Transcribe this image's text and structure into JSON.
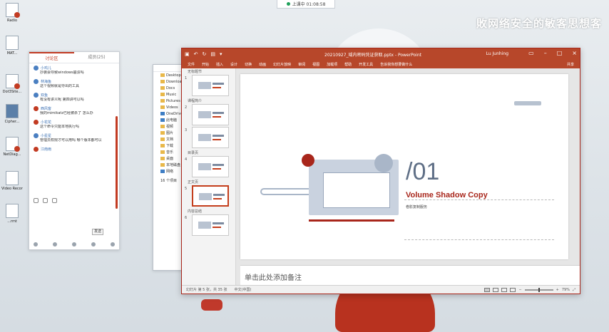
{
  "desktop": {
    "icons": [
      {
        "label": "Radio",
        "style": "red"
      },
      {
        "label": "MAT...",
        "style": "plain"
      },
      {
        "label": "Dot3Site...",
        "style": "red"
      },
      {
        "label": "Cipher...",
        "style": "blue"
      },
      {
        "label": "NetDiag...",
        "style": "red"
      },
      {
        "label": "Video Recording",
        "style": "plain"
      },
      {
        "label": "...rmt",
        "style": "plain"
      }
    ],
    "watermark": "敗网络安全的敏客思想客"
  },
  "meeting_bar": {
    "label": "上课中 01:08:58"
  },
  "chat": {
    "tabs": [
      "讨论区",
      "成员(25)"
    ],
    "active_tab": 0,
    "messages": [
      {
        "user": "小鸡儿",
        "text": "抄袭会导致windows崩溃吗",
        "avatar": "blue"
      },
      {
        "user": "林海鱼",
        "text": "这个视频就是导出的工具",
        "avatar": "blue"
      },
      {
        "user": "双鱼",
        "text": "有没有讲义呢 第四讲可以吗",
        "avatar": "blue"
      },
      {
        "user": "西风客",
        "text": "我的mimikatz已经被杀了 怎么办",
        "avatar": "red"
      },
      {
        "user": "小花花",
        "text": "这个命令只能本地执行吗",
        "avatar": "red"
      },
      {
        "user": "小星星",
        "text": "管理员权限才可以用吗 哪个版本都可以",
        "avatar": "blue"
      },
      {
        "user": "江南雨",
        "text": "",
        "avatar": "red"
      }
    ],
    "send_label": "发送"
  },
  "explorer": {
    "items": [
      {
        "label": "Desktop",
        "icon": "folder-icon"
      },
      {
        "label": "Downloads",
        "icon": "folder-icon"
      },
      {
        "label": "Docs",
        "icon": "folder-icon"
      },
      {
        "label": "Music",
        "icon": "folder-icon"
      },
      {
        "label": "Pictures",
        "icon": "folder-icon"
      },
      {
        "label": "Videos",
        "icon": "folder-icon"
      },
      {
        "label": "OneDrive",
        "icon": "cloud-icon"
      },
      {
        "label": "此电脑",
        "icon": "computer-icon"
      },
      {
        "label": "视频",
        "icon": "folder-icon"
      },
      {
        "label": "图片",
        "icon": "folder-icon"
      },
      {
        "label": "文档",
        "icon": "folder-icon"
      },
      {
        "label": "下载",
        "icon": "folder-icon"
      },
      {
        "label": "音乐",
        "icon": "folder-icon"
      },
      {
        "label": "桌面",
        "icon": "folder-icon"
      },
      {
        "label": "本地磁盘",
        "icon": "drive-icon"
      },
      {
        "label": "网络",
        "icon": "network-icon"
      }
    ],
    "footer": "16 个项目"
  },
  "ppt": {
    "doc_title": "20210927_域内密码凭证获取.pptx - PowerPoint",
    "user": "Lu Junhing",
    "ribbon_tabs": [
      "文件",
      "开始",
      "插入",
      "设计",
      "切换",
      "动画",
      "幻灯片放映",
      "审阅",
      "视图",
      "加载项",
      "帮助",
      "开发工具",
      "告诉我你想要做什么"
    ],
    "share_label": "共享",
    "sections": [
      "无标题节",
      "课程简介",
      "目录页",
      "正文页",
      "内容总结"
    ],
    "thumb_numbers": [
      "1",
      "2",
      "3",
      "4",
      "5",
      "6"
    ],
    "slide": {
      "number": "/01",
      "heading": "Volume Shadow Copy",
      "subheading": "卷影复制服务"
    },
    "notes_placeholder": "单击此处添加备注",
    "status": {
      "slide_info": "幻灯片 第 5 张，共 35 张",
      "language": "中文(中国)",
      "zoom": "79%",
      "zoom_fraction": 0.5
    },
    "colors": {
      "accent": "#b7472a",
      "heading": "#a8261b"
    }
  }
}
